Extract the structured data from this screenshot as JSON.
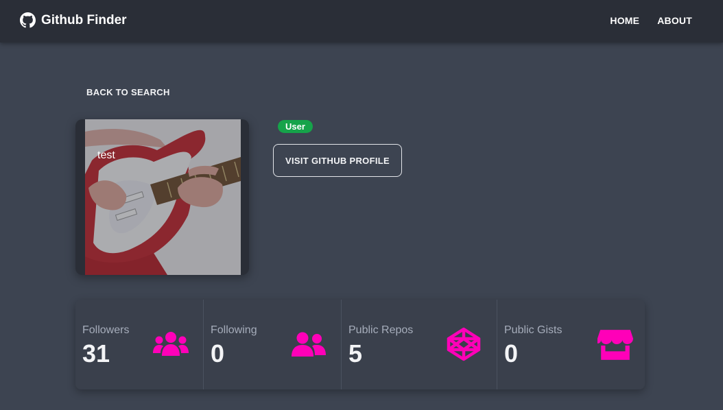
{
  "navbar": {
    "brand": "Github Finder",
    "links": [
      "HOME",
      "ABOUT"
    ]
  },
  "back_button": "BACK TO SEARCH",
  "profile": {
    "name": "test",
    "type_badge": "User",
    "visit_label": "VISIT GITHUB PROFILE"
  },
  "stats": [
    {
      "label": "Followers",
      "value": "31",
      "icon": "users-icon"
    },
    {
      "label": "Following",
      "value": "0",
      "icon": "user-friends-icon"
    },
    {
      "label": "Public Repos",
      "value": "5",
      "icon": "codepen-icon"
    },
    {
      "label": "Public Gists",
      "value": "0",
      "icon": "store-icon"
    }
  ],
  "colors": {
    "navbar_bg": "#2a2e37",
    "page_bg": "#3d4451",
    "accent_pink": "#ff00b8",
    "badge_green": "#16a34a"
  }
}
